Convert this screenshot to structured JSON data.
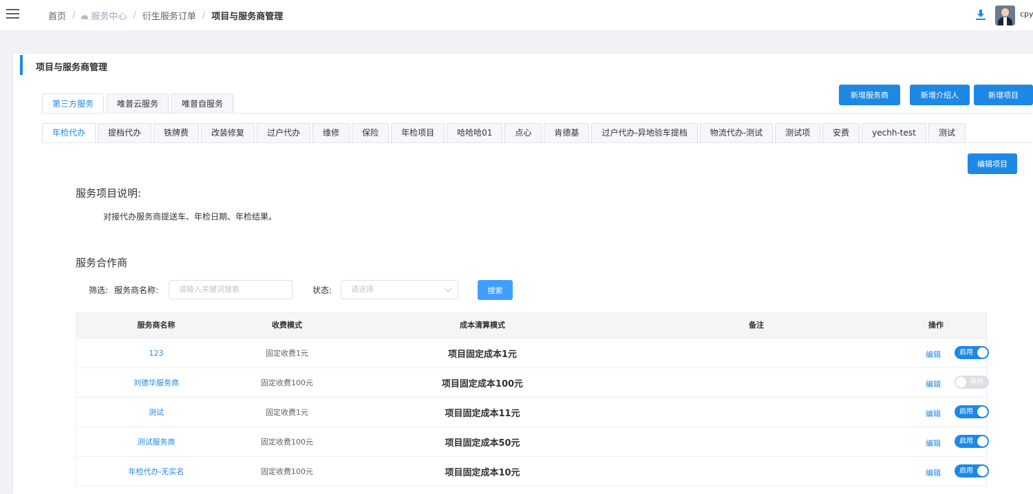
{
  "breadcrumb": {
    "home": "首页",
    "service_center": "服务中心",
    "orders": "衍生服务订单",
    "current": "项目与服务商管理"
  },
  "header": {
    "username": "cpy"
  },
  "page": {
    "title": "项目与服务商管理"
  },
  "actions": {
    "add_vendor": "新增服务商",
    "add_referrer": "新增介绍人",
    "add_project": "新增项目",
    "edit_project": "编辑项目"
  },
  "service_tabs": [
    "第三方服务",
    "唯普云服务",
    "唯普自服务"
  ],
  "project_tabs": [
    "年检代办",
    "提档代办",
    "铁牌费",
    "改装修复",
    "过户代办",
    "维修",
    "保险",
    "年检项目",
    "哈哈哈01",
    "点心",
    "肯德基",
    "过户代办-异地验车提档",
    "物流代办-测试",
    "测试项",
    "安费",
    "yechh-test",
    "测试"
  ],
  "description": {
    "heading": "服务项目说明:",
    "text": "对接代办服务商提送车、年检日期、年检结果。"
  },
  "partners": {
    "heading": "服务合作商",
    "filter_label": "筛选:",
    "name_label": "服务商名称:",
    "name_placeholder": "请输入关键词搜索",
    "status_label": "状态:",
    "status_placeholder": "请选择",
    "search_button": "搜索"
  },
  "table": {
    "headers": [
      "服务商名称",
      "收费模式",
      "成本清算模式",
      "备注",
      "操作"
    ],
    "edit_label": "编辑",
    "on_label": "启用",
    "off_label": "停用",
    "rows": [
      {
        "name": "123",
        "fee": "固定收费1元",
        "cost": "项目固定成本1元",
        "note": "",
        "enabled": true
      },
      {
        "name": "刘德华服务商",
        "fee": "固定收费100元",
        "cost": "项目固定成本100元",
        "note": "",
        "enabled": false
      },
      {
        "name": "测试",
        "fee": "固定收费1元",
        "cost": "项目固定成本11元",
        "note": "",
        "enabled": true
      },
      {
        "name": "测试服务商",
        "fee": "固定收费100元",
        "cost": "项目固定成本50元",
        "note": "",
        "enabled": true
      },
      {
        "name": "年检代办-无实名",
        "fee": "固定收费100元",
        "cost": "项目固定成本10元",
        "note": "",
        "enabled": true
      }
    ]
  },
  "colors": {
    "primary": "#1e88e5",
    "search": "#409eff",
    "disabled": "#dcdfe6"
  }
}
